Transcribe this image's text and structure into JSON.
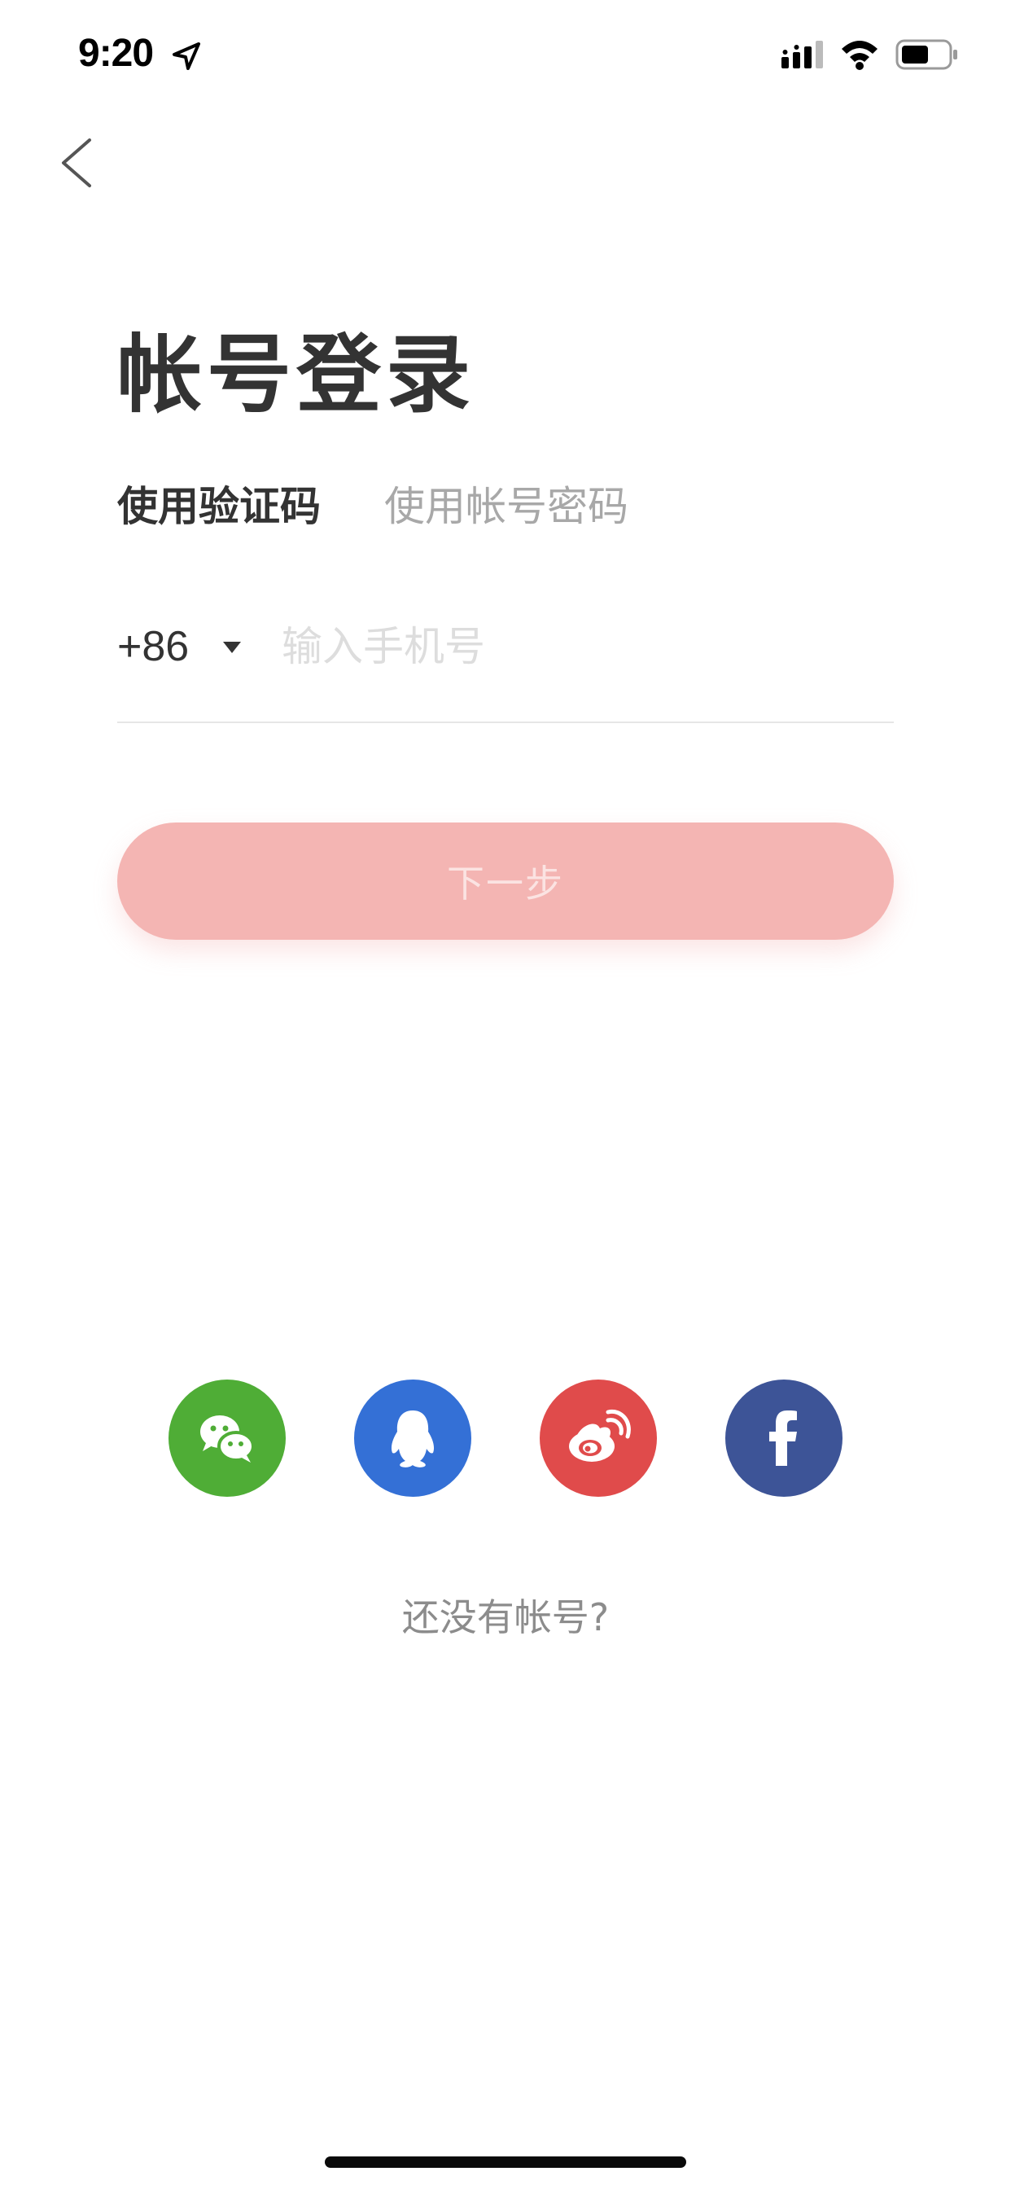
{
  "status_bar": {
    "time": "9:20"
  },
  "title": "帐号登录",
  "tabs": {
    "active": "使用验证码",
    "inactive": "使用帐号密码"
  },
  "phone": {
    "country_code": "+86",
    "placeholder": "输入手机号",
    "value": ""
  },
  "next_button": {
    "label": "下一步"
  },
  "social_logins": [
    "wechat-icon",
    "qq-icon",
    "weibo-icon",
    "facebook-icon"
  ],
  "signup_link": "还没有帐号?",
  "colors": {
    "accent": "#f4b5b3",
    "wechat": "#4fad36",
    "qq": "#3470d6",
    "weibo": "#e04b4b",
    "facebook": "#3d5497"
  }
}
